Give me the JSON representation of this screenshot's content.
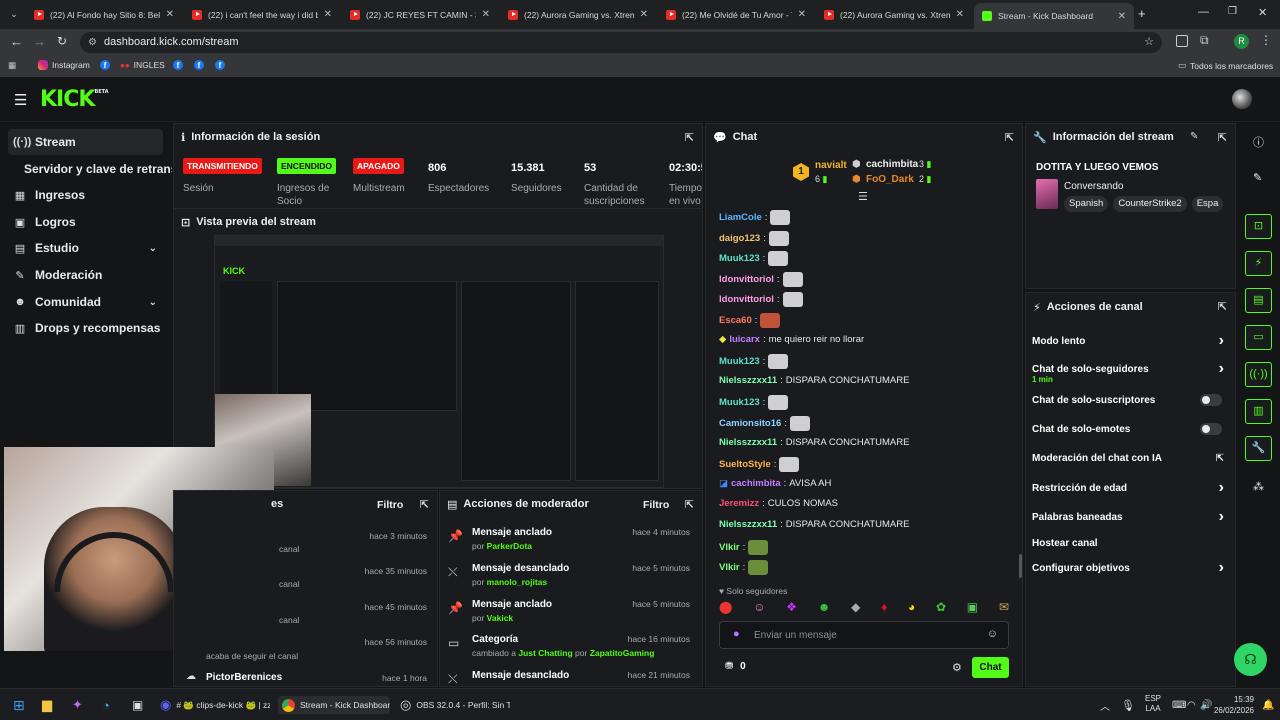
{
  "browser": {
    "tabs": [
      {
        "title": "(22) Al Fondo hay Sitio 8: Belén"
      },
      {
        "title": "(22) i can't feel the way i did be"
      },
      {
        "title": "(22) JC REYES FT CAMIN - 34 A"
      },
      {
        "title": "(22) Aurora Gaming vs. Xtreme"
      },
      {
        "title": "(22) Me Olvidé de Tu Amor - Yo"
      },
      {
        "title": "(22) Aurora Gaming vs. Xtreme"
      },
      {
        "title": "Stream - Kick Dashboard"
      }
    ],
    "url": "dashboard.kick.com/stream",
    "bookmarks": [
      "Instagram",
      "INGLES"
    ],
    "all_bookmarks": "Todos los marcadores",
    "profile_initial": "R"
  },
  "kick": {
    "logo": "KICK",
    "logo_sup": "BETA",
    "nav": [
      {
        "label": "Stream",
        "icon": "stream-icon"
      },
      {
        "label": "Servidor y clave de retransm",
        "icon": ""
      },
      {
        "label": "Ingresos",
        "icon": "revenue-icon"
      },
      {
        "label": "Logros",
        "icon": "achievements-icon"
      },
      {
        "label": "Estudio",
        "icon": "studio-icon"
      },
      {
        "label": "Moderación",
        "icon": "moderation-icon"
      },
      {
        "label": "Comunidad",
        "icon": "community-icon"
      },
      {
        "label": "Drops y recompensas",
        "icon": "drops-icon"
      }
    ],
    "session": {
      "title": "Información de la sesión",
      "stats": [
        {
          "value": "TRANSMITIENDO",
          "label": "Sesión",
          "color": "#e91916"
        },
        {
          "value": "ENCENDIDO",
          "label": "Ingresos de Socio",
          "color": "#53fc18"
        },
        {
          "value": "APAGADO",
          "label": "Multistream",
          "color": "#e91916"
        },
        {
          "value": "806",
          "label": "Espectadores"
        },
        {
          "value": "15.381",
          "label": "Seguidores"
        },
        {
          "value": "53",
          "label": "Cantidad de suscripciones"
        },
        {
          "value": "02:30:5",
          "label": "Tiempo en vivo"
        }
      ]
    },
    "preview": {
      "title": "Vista previa del stream"
    },
    "activity": {
      "filter": "Filtro",
      "rows": [
        {
          "time": "hace 3 minutos",
          "text": "canal"
        },
        {
          "time": "hace 35 minutos",
          "text": "canal"
        },
        {
          "time": "hace 45 minutos",
          "text": "canal"
        },
        {
          "time": "hace 56 minutos",
          "text": "acaba de seguir el canal"
        },
        {
          "name": "PictorBerenices",
          "time": "hace 1 hora"
        }
      ]
    },
    "modactions": {
      "title": "Acciones de moderador",
      "filter": "Filtro",
      "rows": [
        {
          "action": "Mensaje anclado",
          "prefix": "por",
          "user": "ParkerDota",
          "time": "hace 4 minutos"
        },
        {
          "action": "Mensaje desanclado",
          "prefix": "por",
          "user": "manolo_rojitas",
          "time": "hace 5 minutos"
        },
        {
          "action": "Mensaje anclado",
          "prefix": "por",
          "user": "Vakick",
          "time": "hace 5 minutos"
        },
        {
          "action": "Categoría",
          "prefix": "cambiado a",
          "user": "Just Chatting",
          "mid": "por",
          "user2": "ZapatitoGaming",
          "time": "hace 16 minutos"
        },
        {
          "action": "Mensaje desanclado",
          "time": "hace 21 minutos"
        }
      ]
    },
    "chat": {
      "title": "Chat",
      "leaderboard": [
        {
          "rank": "1",
          "name": "navialt",
          "count": "6"
        },
        {
          "name": "cachimbita",
          "count": "3"
        },
        {
          "name": "FoO_Dark",
          "count": "2"
        }
      ],
      "messages": [
        {
          "user": "LiamCole",
          "color": "#5eb8ff",
          "text": ""
        },
        {
          "user": "daigo123",
          "color": "#f5c26b",
          "text": ""
        },
        {
          "user": "Muuk123",
          "color": "#5ee1c9",
          "text": ""
        },
        {
          "user": "ldonvittoriol",
          "color": "#ff9ee6",
          "text": ""
        },
        {
          "user": "ldonvittoriol",
          "color": "#ff9ee6",
          "text": ""
        },
        {
          "user": "Esca60",
          "color": "#ff7b5c",
          "text": ""
        },
        {
          "user": "luicarx",
          "color": "#c77dff",
          "text": "me quiero reir no llorar"
        },
        {
          "user": "Muuk123",
          "color": "#5ee1c9",
          "text": ""
        },
        {
          "user": "Nielsszzxx11",
          "color": "#7dffb0",
          "text": "DISPARA CONCHATUMARE"
        },
        {
          "user": "Muuk123",
          "color": "#5ee1c9",
          "text": ""
        },
        {
          "user": "Camionsito16",
          "color": "#8fd3ff",
          "text": ""
        },
        {
          "user": "Nielsszzxx11",
          "color": "#7dffb0",
          "text": "DISPARA CONCHATUMARE"
        },
        {
          "user": "SueltoStyle",
          "color": "#ffb347",
          "text": ""
        },
        {
          "user": "cachimbita",
          "color": "#c77dff",
          "text": "AVISA AH"
        },
        {
          "user": "Jeremizz",
          "color": "#ff4f7a",
          "text": "CULOS NOMAS"
        },
        {
          "user": "Nielsszzxx11",
          "color": "#7dffb0",
          "text": "DISPARA CONCHATUMARE"
        },
        {
          "user": "Vlkir",
          "color": "#7dff7d",
          "text": ""
        },
        {
          "user": "Vlkir",
          "color": "#7dff7d",
          "text": ""
        }
      ],
      "mode": "Solo seguidores",
      "placeholder": "Enviar un mensaje",
      "points": "0",
      "send": "Chat"
    },
    "streaminfo": {
      "title": "Información del stream",
      "stream_title": "DOTITA Y LUEGO VEMOS",
      "category": "Conversando",
      "tags": [
        "Spanish",
        "CounterStrike2",
        "Espa"
      ]
    },
    "channel": {
      "title": "Acciones de canal",
      "items": [
        {
          "label": "Modo lento",
          "type": "arrow"
        },
        {
          "label": "Chat de solo-seguidores",
          "sub": "1 min",
          "type": "arrow"
        },
        {
          "label": "Chat de solo-suscriptores",
          "type": "toggle"
        },
        {
          "label": "Chat de solo-emotes",
          "type": "toggle"
        },
        {
          "label": "Moderación del chat con IA",
          "type": "external"
        },
        {
          "label": "Restricción de edad",
          "type": "arrow"
        },
        {
          "label": "Palabras baneadas",
          "type": "arrow"
        },
        {
          "label": "Hostear canal",
          "type": "none"
        },
        {
          "label": "Configurar objetivos",
          "type": "arrow"
        }
      ]
    },
    "colors": {
      "accent": "#53fc18",
      "bg": "#141517",
      "panel": "#191b1f"
    }
  },
  "taskbar": {
    "discord_label": "# 🐸 clips-de-kick 🐸 | zz",
    "chrome_label": "Stream - Kick Dashboard",
    "obs_label": "OBS 32.0.4 - Perfil: Sin T",
    "lang": "ESP",
    "lang2": "LAA",
    "time": "15:39",
    "date": "26/02/2026"
  }
}
